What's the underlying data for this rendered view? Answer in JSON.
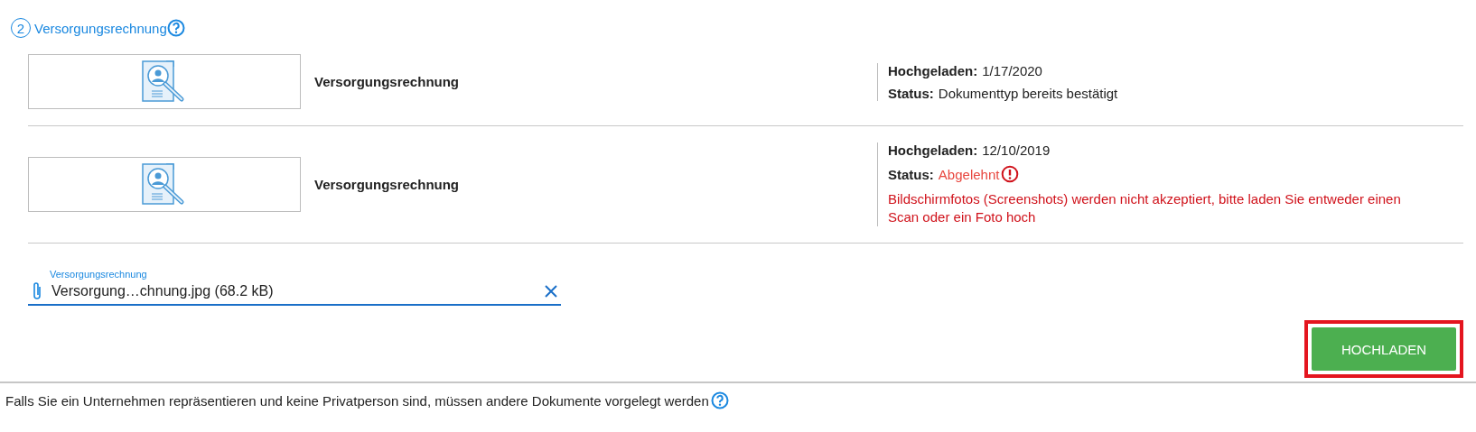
{
  "section": {
    "step": "2",
    "title": "Versorgungsrechnung"
  },
  "documents": [
    {
      "name": "Versorgungsrechnung",
      "uploaded_label": "Hochgeladen:",
      "uploaded": "1/17/2020",
      "status_label": "Status:",
      "status": "Dokumenttyp bereits bestätigt",
      "kind": "confirmed"
    },
    {
      "name": "Versorgungsrechnung",
      "uploaded_label": "Hochgeladen:",
      "uploaded": "12/10/2019",
      "status_label": "Status:",
      "status": "Abgelehnt",
      "kind": "rejected",
      "message": "Bildschirmfotos (Screenshots) werden nicht akzeptiert, bitte laden Sie entweder einen Scan oder ein Foto hoch"
    }
  ],
  "file_field": {
    "label": "Versorgungsrechnung",
    "value": "Versorgung…chnung.jpg (68.2 kB)"
  },
  "upload_button": {
    "label": "HOCHLADEN",
    "highlighted": true
  },
  "footer": {
    "text": "Falls Sie ein Unternehmen repräsentieren und keine Privatperson sind, müssen andere Dokumente vorgelegt werden"
  }
}
